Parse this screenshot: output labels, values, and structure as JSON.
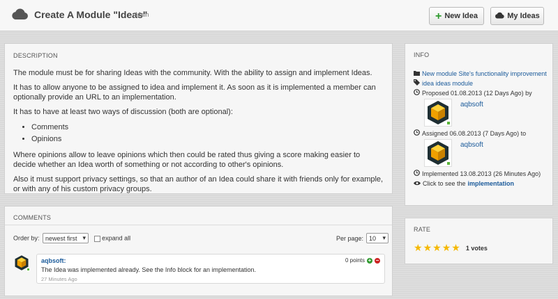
{
  "header": {
    "title": "Create A Module \"Ideas\"",
    "crumb": "Main",
    "new_idea_label": "New Idea",
    "my_ideas_label": "My Ideas"
  },
  "description": {
    "heading": "DESCRIPTION",
    "p1": "The module must be for sharing Ideas with the community. With the ability to assign and implement Ideas.",
    "p2": "It has to allow anyone to be assigned to idea and implement it. As soon as it is implemented a member can optionally provide an URL to an implementation.",
    "p3": "It has to have at least two ways of discussion (both are optional):",
    "bullets": [
      "Comments",
      "Opinions"
    ],
    "p4": "Where opinions allow to leave opinions which then could be rated thus giving a score making easier to decide whether an Idea worth of something or not according to other's opinions.",
    "p5": "Also it must support privacy settings, so that an author of an Idea could share it with friends only for example, or with any of his custom privacy groups."
  },
  "info": {
    "heading": "INFO",
    "category_link": "New module Site's functionality improvement",
    "tag_link": "idea ideas module",
    "proposed": "Proposed 01.08.2013 (12 Days Ago) by",
    "proposer": "aqbsoft",
    "assigned": "Assigned 06.08.2013 (7 Days Ago) to",
    "assignee": "aqbsoft",
    "implemented": "Implemented 13.08.2013 (26 Minutes Ago)",
    "click_prefix": "Click to see the",
    "implementation_link": "implementation"
  },
  "rate": {
    "heading": "RATE",
    "stars_filled": 5,
    "votes": "1 votes"
  },
  "comments": {
    "heading": "COMMENTS",
    "order_by_label": "Order by:",
    "order_value": "newest first",
    "expand_all_label": "expand all",
    "per_page_label": "Per page:",
    "per_page_value": "10",
    "items": [
      {
        "author": "aqbsoft:",
        "text": "The Idea was implemented already. See the Info block for an implementation.",
        "time": "27 Minutes Ago",
        "points": "0 points"
      }
    ]
  },
  "colors": {
    "link": "#1a5a9a",
    "star": "#f5b800",
    "online": "#5ab63a",
    "vote_up": "#2e9a2e",
    "vote_down": "#cc2222"
  },
  "icons": [
    "cloud-icon",
    "plus-icon",
    "cloud-icon",
    "folder-icon",
    "tag-icon",
    "clock-icon",
    "eye-icon",
    "star-icon",
    "thumb-up-icon",
    "thumb-down-icon"
  ]
}
